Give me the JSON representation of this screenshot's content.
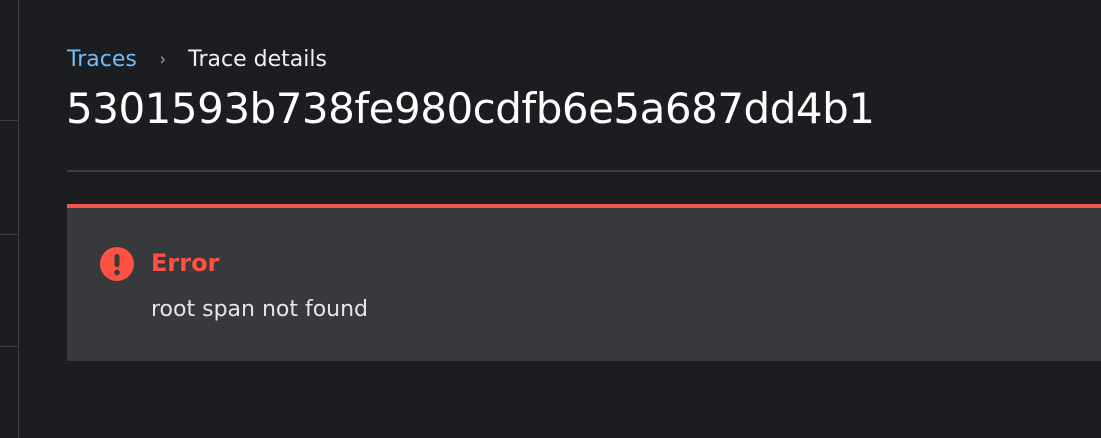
{
  "breadcrumb": {
    "parent": "Traces",
    "separator": "›",
    "current": "Trace details"
  },
  "page": {
    "title": "5301593b738fe980cdfb6e5a687dd4b1"
  },
  "alert": {
    "icon": "exclamation-circle-icon",
    "title": "Error",
    "message": "root span not found",
    "color": "#fe5142"
  },
  "colors": {
    "background": "#1b1d21",
    "link": "#73bcf7",
    "alert_background": "#38393c",
    "danger": "#f0564b"
  }
}
